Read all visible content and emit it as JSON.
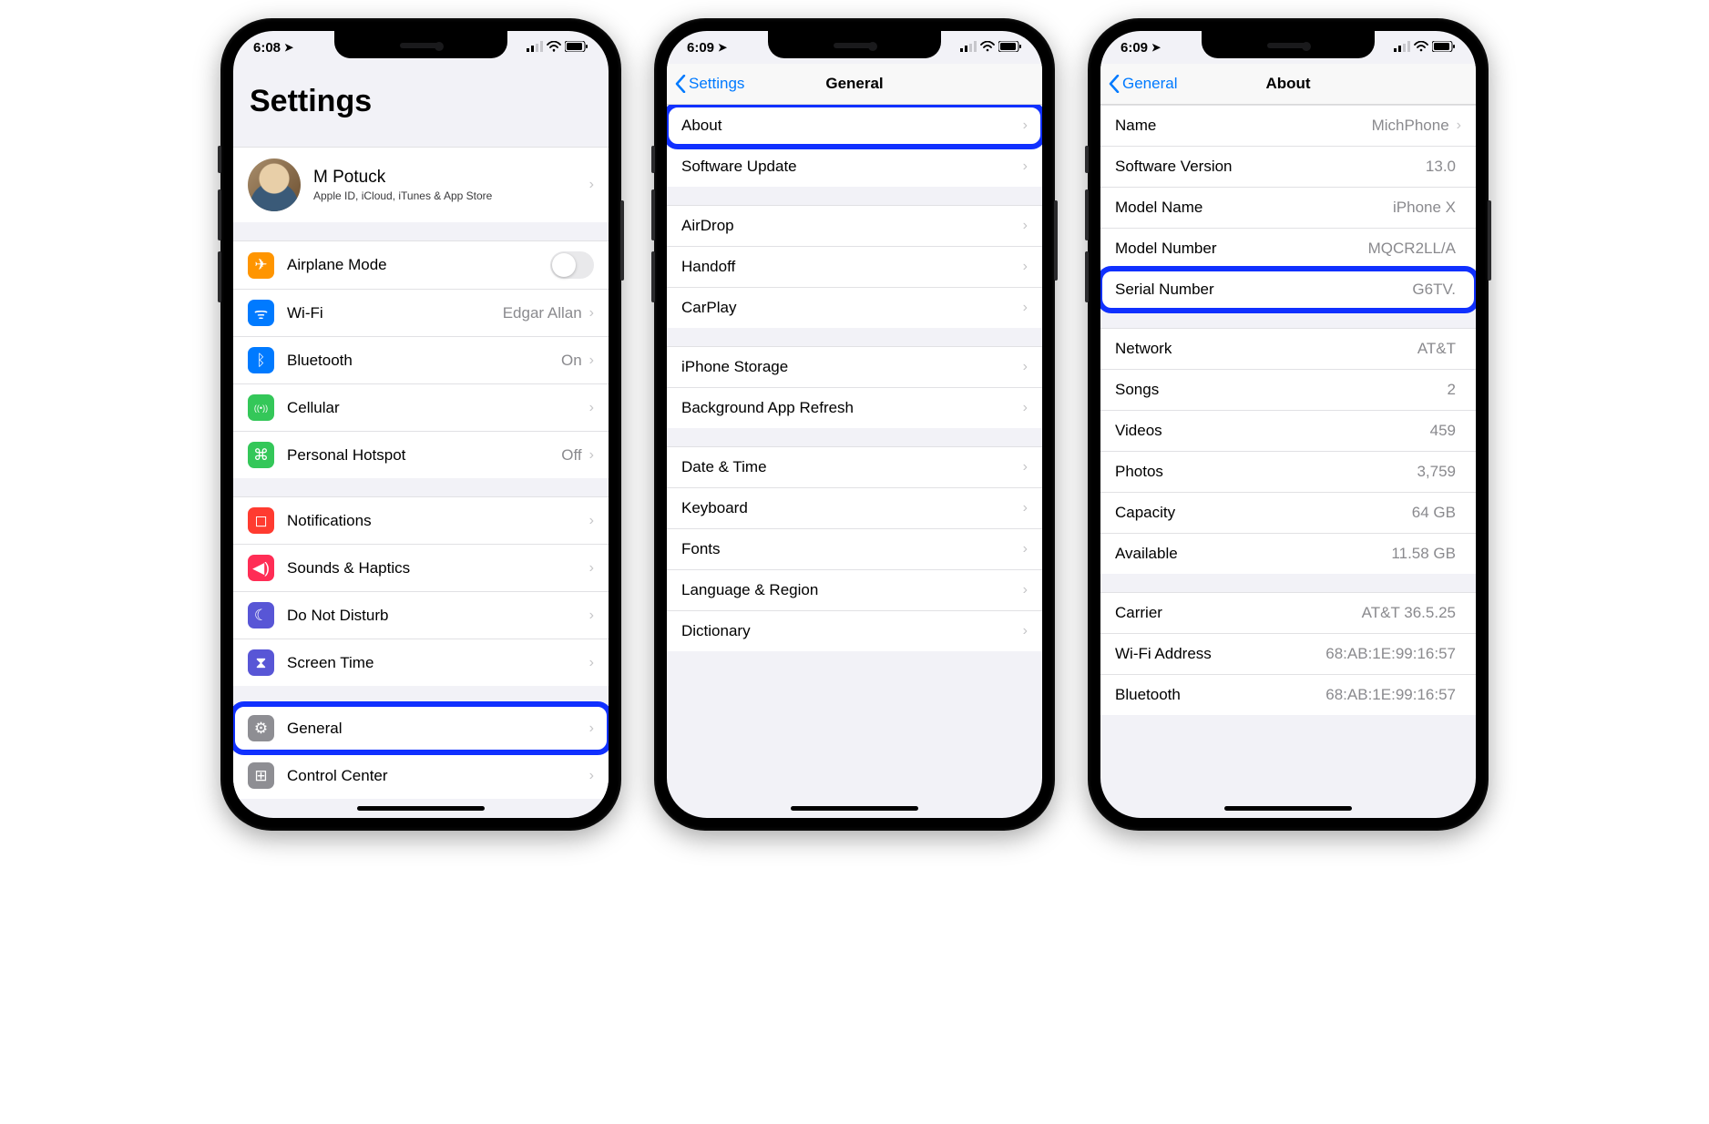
{
  "screens": [
    {
      "status_time": "6:08",
      "large_title": "Settings",
      "profile_name": "M Potuck",
      "profile_sub": "Apple ID, iCloud, iTunes & App Store",
      "groups": [
        [
          {
            "label": "Airplane Mode",
            "icon": "plane",
            "accessory": "toggle"
          },
          {
            "label": "Wi-Fi",
            "icon": "wifi",
            "value": "Edgar Allan",
            "accessory": "chevron"
          },
          {
            "label": "Bluetooth",
            "icon": "bt",
            "value": "On",
            "accessory": "chevron"
          },
          {
            "label": "Cellular",
            "icon": "cell",
            "accessory": "chevron"
          },
          {
            "label": "Personal Hotspot",
            "icon": "hotspot",
            "value": "Off",
            "accessory": "chevron"
          }
        ],
        [
          {
            "label": "Notifications",
            "icon": "notif",
            "accessory": "chevron"
          },
          {
            "label": "Sounds & Haptics",
            "icon": "sound",
            "accessory": "chevron"
          },
          {
            "label": "Do Not Disturb",
            "icon": "dnd",
            "accessory": "chevron"
          },
          {
            "label": "Screen Time",
            "icon": "time",
            "accessory": "chevron"
          }
        ],
        [
          {
            "label": "General",
            "icon": "gear",
            "accessory": "chevron",
            "highlighted": true
          },
          {
            "label": "Control Center",
            "icon": "ctrl",
            "accessory": "chevron"
          }
        ]
      ]
    },
    {
      "status_time": "6:09",
      "nav_back": "Settings",
      "nav_title": "General",
      "groups": [
        [
          {
            "label": "About",
            "accessory": "chevron",
            "highlighted": true
          },
          {
            "label": "Software Update",
            "accessory": "chevron"
          }
        ],
        [
          {
            "label": "AirDrop",
            "accessory": "chevron"
          },
          {
            "label": "Handoff",
            "accessory": "chevron"
          },
          {
            "label": "CarPlay",
            "accessory": "chevron"
          }
        ],
        [
          {
            "label": "iPhone Storage",
            "accessory": "chevron"
          },
          {
            "label": "Background App Refresh",
            "accessory": "chevron"
          }
        ],
        [
          {
            "label": "Date & Time",
            "accessory": "chevron"
          },
          {
            "label": "Keyboard",
            "accessory": "chevron"
          },
          {
            "label": "Fonts",
            "accessory": "chevron"
          },
          {
            "label": "Language & Region",
            "accessory": "chevron"
          },
          {
            "label": "Dictionary",
            "accessory": "chevron"
          }
        ]
      ]
    },
    {
      "status_time": "6:09",
      "nav_back": "General",
      "nav_title": "About",
      "groups": [
        [
          {
            "label": "Name",
            "value": "MichPhone",
            "accessory": "chevron"
          },
          {
            "label": "Software Version",
            "value": "13.0"
          },
          {
            "label": "Model Name",
            "value": "iPhone X"
          },
          {
            "label": "Model Number",
            "value": "MQCR2LL/A"
          },
          {
            "label": "Serial Number",
            "value": "G6TV.",
            "highlighted": true
          }
        ],
        [
          {
            "label": "Network",
            "value": "AT&T"
          },
          {
            "label": "Songs",
            "value": "2"
          },
          {
            "label": "Videos",
            "value": "459"
          },
          {
            "label": "Photos",
            "value": "3,759"
          },
          {
            "label": "Capacity",
            "value": "64 GB"
          },
          {
            "label": "Available",
            "value": "11.58 GB"
          }
        ],
        [
          {
            "label": "Carrier",
            "value": "AT&T 36.5.25"
          },
          {
            "label": "Wi-Fi Address",
            "value": "68:AB:1E:99:16:57"
          },
          {
            "label": "Bluetooth",
            "value": "68:AB:1E:99:16:57"
          }
        ]
      ]
    }
  ],
  "icon_glyph": {
    "plane": "✈︎",
    "wifi": "ᯤ",
    "bt": "ᛒ",
    "cell": "((•))",
    "hotspot": "⌘",
    "notif": "◻︎",
    "sound": "◀︎)",
    "dnd": "☾",
    "time": "⧗",
    "gear": "⚙︎",
    "ctrl": "⊞"
  }
}
